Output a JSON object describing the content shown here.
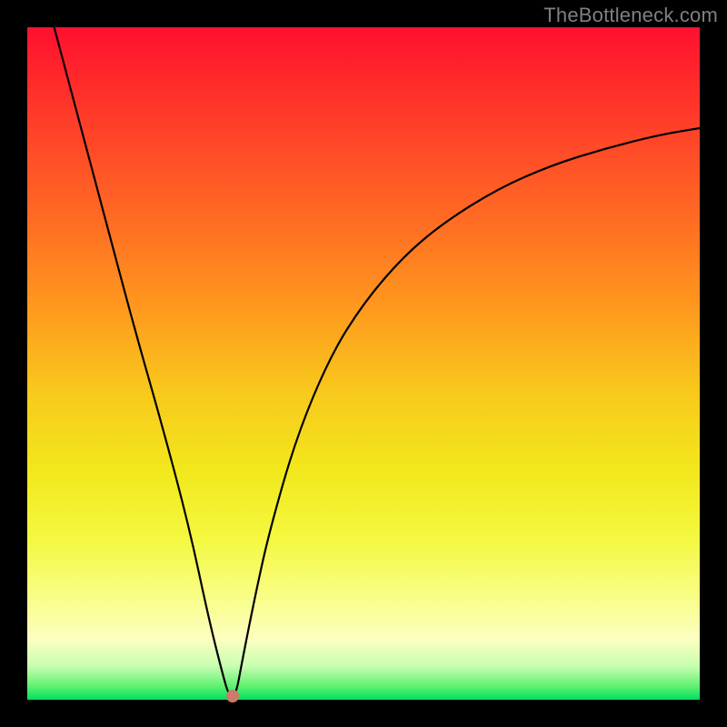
{
  "watermark": "TheBottleneck.com",
  "chart_data": {
    "type": "line",
    "title": "",
    "xlabel": "",
    "ylabel": "",
    "xlim": [
      0,
      100
    ],
    "ylim": [
      0,
      100
    ],
    "grid": false,
    "legend": null,
    "series": [
      {
        "name": "curve",
        "x": [
          4,
          8,
          12,
          16,
          20,
          24,
          27,
          29,
          30,
          31,
          32,
          34,
          36,
          40,
          45,
          50,
          56,
          62,
          70,
          78,
          86,
          94,
          100
        ],
        "values": [
          100,
          85,
          70,
          55,
          41,
          26,
          12,
          4,
          0.5,
          0.5,
          6,
          16,
          25,
          39,
          51,
          59,
          66,
          71,
          76,
          79.5,
          82,
          84,
          85
        ]
      }
    ],
    "marker": {
      "x": 30.5,
      "y": 0.5,
      "color": "#d07a6a"
    },
    "background_gradient": {
      "top": "#ff1030",
      "bottom": "#00e060",
      "type": "red-yellow-green vertical"
    },
    "frame_color": "#000000"
  }
}
